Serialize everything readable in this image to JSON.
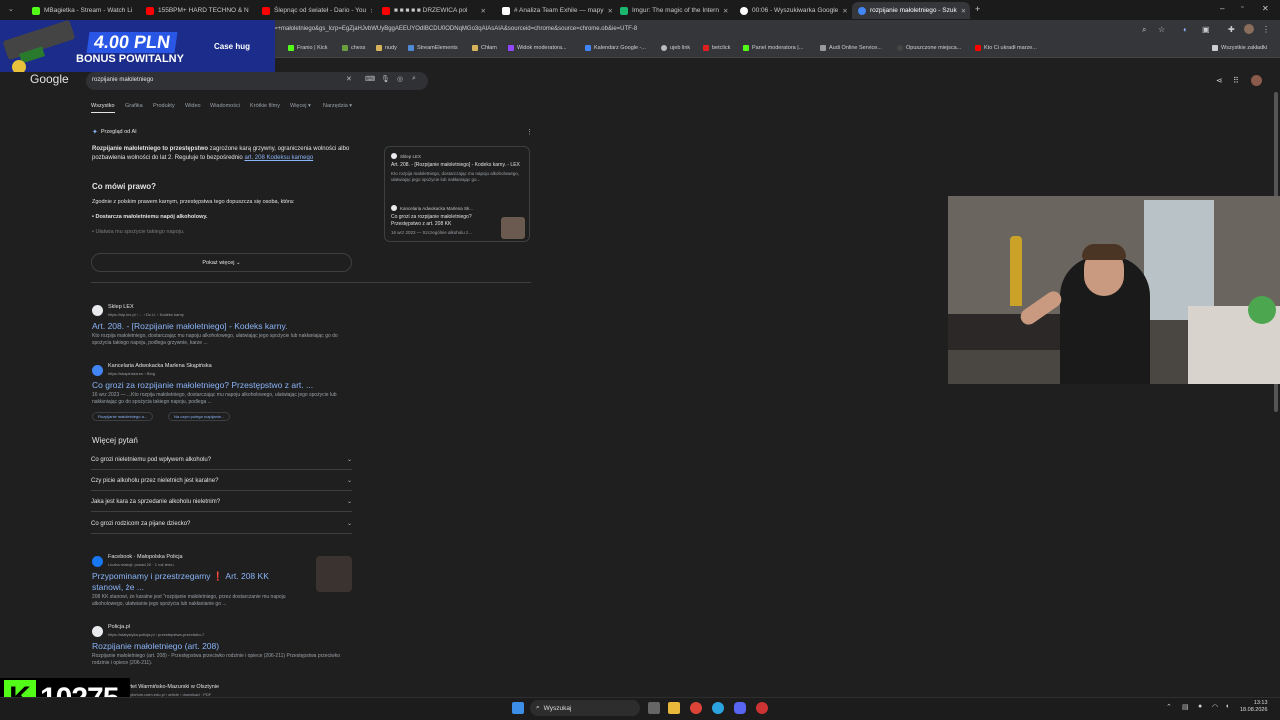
{
  "tabs": [
    {
      "label": "MBagietka - Stream - Watch Li",
      "color": "#53fc18"
    },
    {
      "label": "155BPM+ HARD TECHNO & N",
      "color": "#ff0000"
    },
    {
      "label": "Ślepnąc od świateł - Dario - You",
      "color": "#ff0000"
    },
    {
      "label": "■ ■ ■ ■ ■ DRZEWICA pol",
      "color": "#ff0000"
    },
    {
      "label": "# Analiza Team Exhile — mapy",
      "color": "#ffffff"
    },
    {
      "label": "Imgur: The magic of the Intern",
      "color": "#1bb76e"
    },
    {
      "label": "00:06 - Wyszukiwarka Google",
      "color": "#ffffff"
    },
    {
      "label": "rozpijanie małoletniego - Szuk",
      "color": "#4285f4",
      "active": true
    }
  ],
  "url": "=+małoletniego&gs_lcrp=EgZjaHJvbWUyBggAEEUYOdIBCDU0ODNqMGo3qAIAsAIA&sourceid=chrome&source=chrome.ob&ie=UTF-8",
  "bookmarks": [
    "Franio | Kick",
    "chess",
    "nudy",
    "StreamElements",
    "Chłam",
    "Widok moderatora...",
    "Kalendarz Google -...",
    "ujeb link",
    "betclick",
    "Panel moderatora |...",
    "Audi Online Service...",
    "Opuszczone miejsca...",
    "Kto Ci ukradł marze...",
    "Wszystkie zakładki"
  ],
  "promo": {
    "amount": "4.00 PLN",
    "bonus": "BONUS POWITALNY",
    "brand": "Case hug"
  },
  "google": {
    "logo": "Google",
    "query": "rozpijanie małoletniego",
    "tabs": [
      "Wszystko",
      "Grafika",
      "Produkty",
      "Wideo",
      "Wiadomości",
      "Krótkie filmy",
      "Więcej ▾",
      "Narzędzia ▾"
    ]
  },
  "ai": {
    "label": "Przegląd od AI",
    "summary_bold": "Rozpijanie małoletniego to przestępstwo",
    "summary_rest": " zagrożone karą grzywny, ograniczenia wolności albo pozbawienia wolności do lat 2. Reguluje to bezpośrednio ",
    "summary_link": "art. 208 Kodeksu karnego",
    "heading": "Co mówi prawo?",
    "intro": "Zgodnie z polskim prawem karnym, przestępstwa tego dopuszcza się osoba, która:",
    "bullet1": "Dostarcza małoletniemu napój alkoholowy.",
    "bullet2": "Ułatwia mu spożycie takiego napoju.",
    "show_more": "Pokaż więcej",
    "side_src1": "Sklep LEX",
    "side_title1": "Art. 208. - [Rozpijanie małoletniego] - Kodeks karny. - LEX",
    "side_snip1": "Kto rozpija małoletniego, dostarczając mu napoju alkoholowego, ułatwiając jego spożycie lub nakłaniając go...",
    "side_src2": "Kancelaria Adwokacka Marlena Sk...",
    "side_title2": "Co grozi za rozpijanie małoletniego? Przestępstwo z art. 208 KK",
    "side_snip2": "16 wrz 2023 — Szczególnie alkoholu z..."
  },
  "results": [
    {
      "source": "Sklep LEX",
      "url": "https://sip.lex.pl › ... › Dz.U. › Kodeks karny",
      "title": "Art. 208. - [Rozpijanie małoletniego] - Kodeks karny.",
      "snippet": "Kto rozpija małoletniego, dostarczając mu napoju alkoholowego, ułatwiając jego spożycie lub nakłaniając go do spożycia takiego napoju, podlega grzywnie, karze ..."
    },
    {
      "source": "Kancelaria Adwokacka Marlena Skąpińska",
      "url": "https://skapinska.eu › Blog",
      "title": "Co grozi za rozpijanie małoletniego? Przestępstwo z art. ...",
      "snippet": "16 wrz 2023 — ...Kto rozpija małoletniego, dostarczając mu napoju alkoholowego, ułatwiając jego spożycie lub nakłaniając go do spożycia takiego napoju, podlega ...",
      "chips": [
        "Rozpijanie małoletniego a...",
        "Na czym polega rozpijanie..."
      ]
    }
  ],
  "paa": {
    "heading": "Więcej pytań",
    "questions": [
      "Co grozi nieletniemu pod wpływem alkoholu?",
      "Czy picie alkoholu przez nieletnich jest karalne?",
      "Jaka jest kara za sprzedanie alkoholu nieletnim?",
      "Co grozi rodzicom za pijane dziecko?"
    ]
  },
  "results2": [
    {
      "source": "Facebook · Małopolska Policja",
      "url": "Liczba reakcji: ponad 20 · 1 rok temu",
      "title": "Przypominamy i przestrzegamy ❗ Art. 208 KK stanowi, że ...",
      "snippet": "208 KK stanowi, że karalne jest \"rozpijanie małoletniego, przez dostarczanie mu napoju alkoholowego, ułatwianie jego spożycia lub nakłanianie go ..."
    },
    {
      "source": "Policja.pl",
      "url": "https://statystyka.policja.pl › przestepstwa-przeciwko-7",
      "title": "Rozpijanie małoletniego (art. 208)",
      "snippet": "Rozpijanie małoletniego (art. 208) - Przestępstwa przeciwko rodzinie i opiece (206-211) Przestępstwa przeciwko rodzinie i opiece (206-211)."
    },
    {
      "source": "Uniwersytet Warmińsko-Mazurski w Olsztynie",
      "url": "https://repozytorium.uwm.edu.pl › article › download · PDF"
    }
  ],
  "counter": {
    "k": "K",
    "value": "10275"
  },
  "taskbar": {
    "search": "Wyszukaj",
    "time": "13:13",
    "date": "18.08.2026"
  }
}
